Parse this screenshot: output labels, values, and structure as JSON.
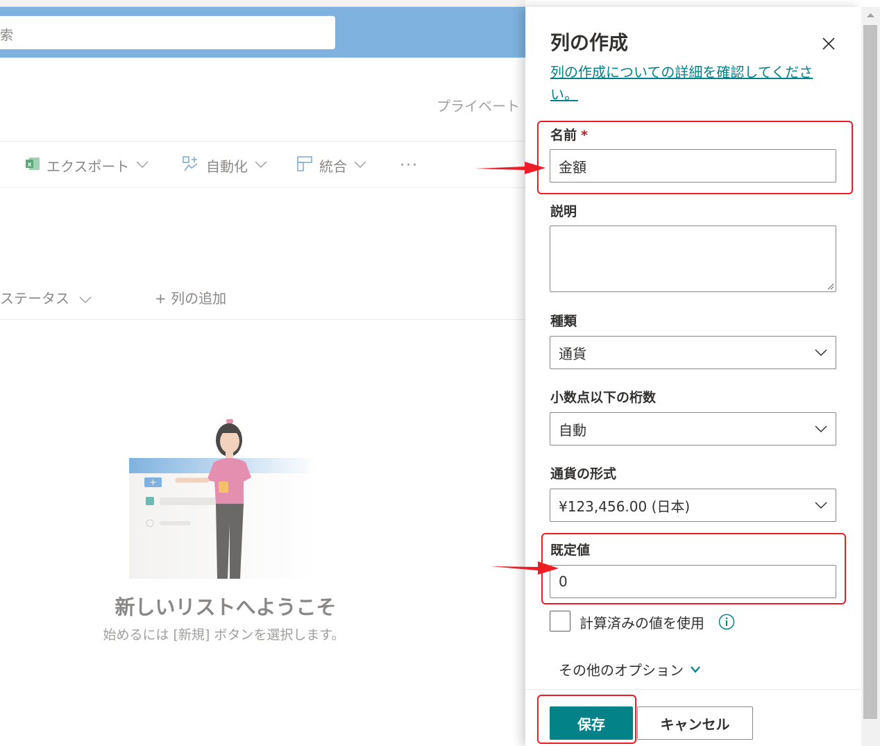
{
  "background": {
    "search_placeholder": "索",
    "private_label": "プライベート",
    "commands": {
      "export": "エクスポート",
      "automate": "自動化",
      "integrate": "統合",
      "more": "···"
    },
    "columns": {
      "status": "ステータス",
      "add_column": "+ 列の追加"
    },
    "welcome": {
      "title": "新しいリストへようこそ",
      "subtitle": "始めるには [新規] ボタンを選択します。"
    }
  },
  "panel": {
    "title": "列の作成",
    "learn_more_link": "列の作成についての詳細を確認してください。",
    "fields": {
      "name": {
        "label": "名前",
        "required_mark": "*",
        "value": "金額"
      },
      "description": {
        "label": "説明",
        "value": ""
      },
      "type": {
        "label": "種類",
        "selected": "通貨"
      },
      "decimals": {
        "label": "小数点以下の桁数",
        "selected": "自動"
      },
      "currency_format": {
        "label": "通貨の形式",
        "selected": "¥123,456.00 (日本)"
      },
      "default_value": {
        "label": "既定値",
        "value": "0"
      }
    },
    "calculated_value": {
      "label": "計算済みの値を使用",
      "checked": false
    },
    "more_options": "その他のオプション",
    "buttons": {
      "save": "保存",
      "cancel": "キャンセル"
    }
  },
  "colors": {
    "accent": "#038387",
    "annotation": "#ee1c25",
    "suite_bar": "#7fb2df"
  },
  "icons": [
    "excel-icon",
    "automate-icon",
    "integrate-icon",
    "close-icon",
    "chevron-down-icon",
    "info-icon"
  ]
}
